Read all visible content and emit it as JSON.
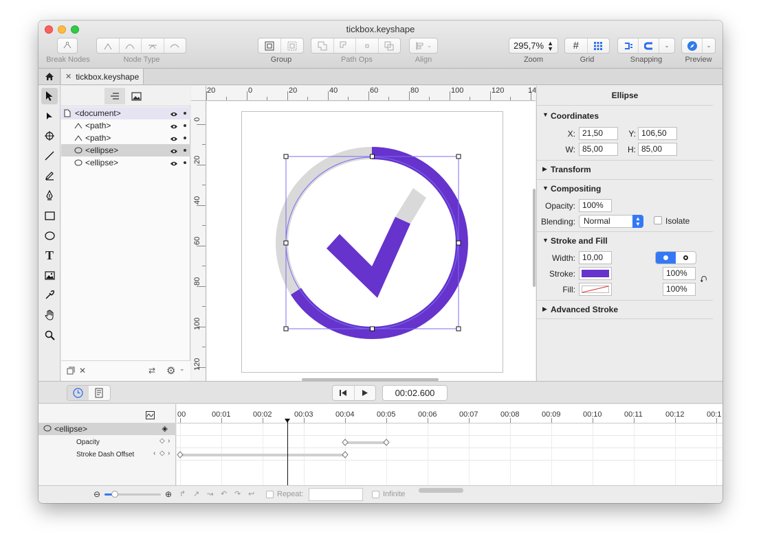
{
  "window": {
    "title": "tickbox.keyshape"
  },
  "toolbar": {
    "break_nodes_label": "Break Nodes",
    "node_type_label": "Node Type",
    "group_label": "Group",
    "path_ops_label": "Path Ops",
    "align_label": "Align",
    "zoom_value": "295,7%",
    "zoom_label": "Zoom",
    "grid_label": "Grid",
    "snapping_label": "Snapping",
    "preview_label": "Preview"
  },
  "tab": {
    "title": "tickbox.keyshape"
  },
  "layers": [
    {
      "label": "<document>",
      "icon": "document-icon"
    },
    {
      "label": "<path>",
      "icon": "path-icon"
    },
    {
      "label": "<path>",
      "icon": "path-icon"
    },
    {
      "label": "<ellipse>",
      "icon": "ellipse-icon"
    },
    {
      "label": "<ellipse>",
      "icon": "ellipse-icon"
    }
  ],
  "rulers": {
    "horizontal": [
      "20",
      "0",
      "20",
      "40",
      "60",
      "80",
      "100",
      "120",
      "14"
    ],
    "vertical": [
      "0",
      "20",
      "40",
      "60",
      "80",
      "100",
      "120"
    ]
  },
  "inspector": {
    "title": "Ellipse",
    "coordinates": {
      "header": "Coordinates",
      "x_label": "X:",
      "x": "21,50",
      "y_label": "Y:",
      "y": "106,50",
      "w_label": "W:",
      "w": "85,00",
      "h_label": "H:",
      "h": "85,00"
    },
    "transform_header": "Transform",
    "compositing": {
      "header": "Compositing",
      "opacity_label": "Opacity:",
      "opacity": "100%",
      "blending_label": "Blending:",
      "blending": "Normal",
      "isolate_label": "Isolate"
    },
    "stroke_fill": {
      "header": "Stroke and Fill",
      "width_label": "Width:",
      "width": "10,00",
      "stroke_label": "Stroke:",
      "stroke_color": "#6633cc",
      "stroke_opacity": "100%",
      "fill_label": "Fill:",
      "fill_opacity": "100%"
    },
    "advanced_stroke_header": "Advanced Stroke"
  },
  "timeline": {
    "current_time": "00:02.600",
    "layer": "<ellipse>",
    "properties": [
      {
        "label": "Opacity"
      },
      {
        "label": "Stroke Dash Offset"
      }
    ],
    "ticks": [
      ":00",
      "00:01",
      "00:02",
      "00:03",
      "00:04",
      "00:05",
      "00:06",
      "00:07",
      "00:08",
      "00:09",
      "00:10",
      "00:11",
      "00:12",
      "00:1"
    ],
    "repeat_label": "Repeat:",
    "infinite_label": "Infinite"
  },
  "colors": {
    "accent": "#6633cc",
    "ring_gray": "#d9d9d9",
    "selection_blue": "#7b6cf0",
    "toggle_blue": "#3478f6"
  }
}
